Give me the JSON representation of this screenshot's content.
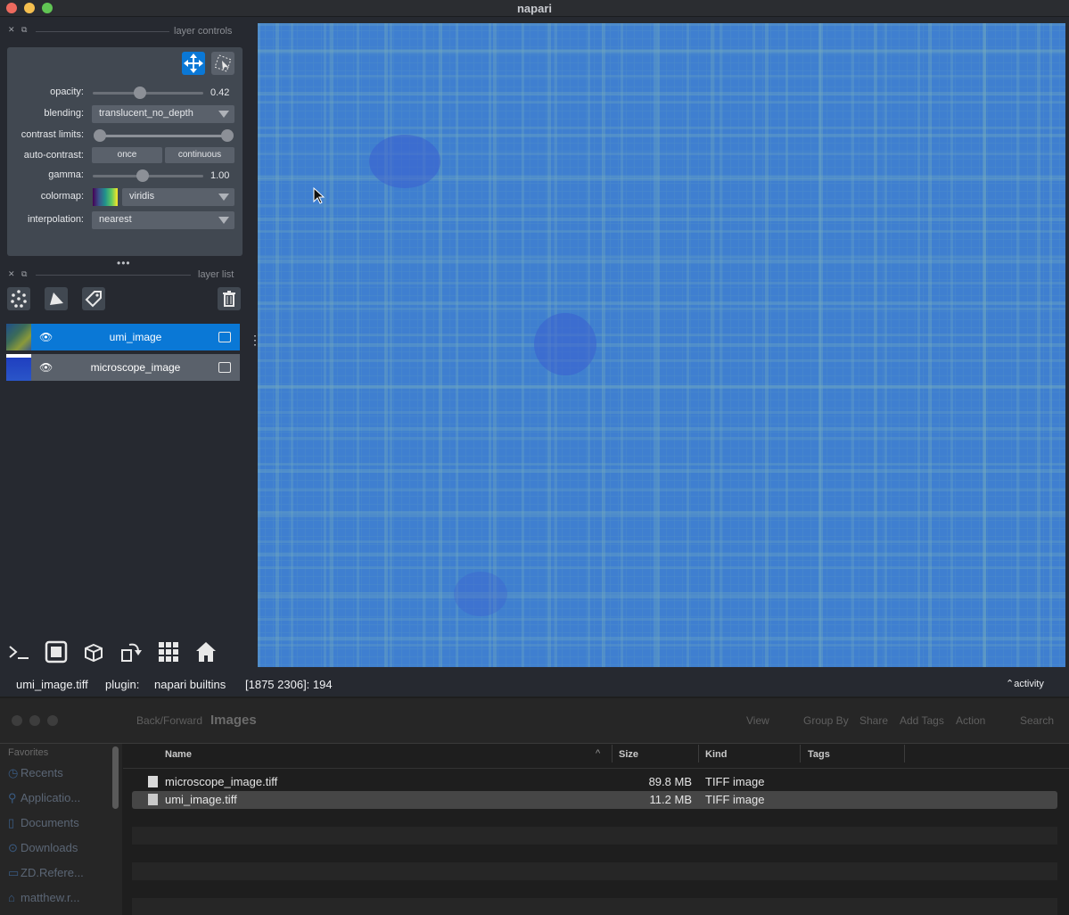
{
  "window": {
    "title": "napari",
    "close_color": "#ed6a5e",
    "min_color": "#f5bf4f",
    "max_color": "#61c554"
  },
  "layer_controls": {
    "header": "layer controls",
    "opacity": {
      "label": "opacity:",
      "value": "0.42",
      "fraction": 0.42
    },
    "blending": {
      "label": "blending:",
      "value": "translucent_no_depth"
    },
    "contrast_limits": {
      "label": "contrast limits:"
    },
    "auto_contrast": {
      "label": "auto-contrast:",
      "once": "once",
      "continuous": "continuous"
    },
    "gamma": {
      "label": "gamma:",
      "value": "1.00"
    },
    "colormap": {
      "label": "colormap:",
      "value": "viridis"
    },
    "interpolation": {
      "label": "interpolation:",
      "value": "nearest"
    },
    "mode_icons": [
      "move-arrows-icon",
      "transform-icon"
    ]
  },
  "layer_list": {
    "header": "layer list",
    "tools": [
      "points-icon",
      "shapes-icon",
      "labels-icon",
      "trash-icon"
    ],
    "layers": [
      {
        "name": "umi_image",
        "selected": true,
        "visible": true
      },
      {
        "name": "microscope_image",
        "selected": false,
        "visible": true
      }
    ]
  },
  "bottom_toolbar": [
    "console-icon",
    "ndisplay-icon",
    "roll-dims-icon",
    "transpose-icon",
    "grid-icon",
    "home-icon"
  ],
  "status": {
    "file": "umi_image.tiff",
    "plugin_label": "plugin:",
    "plugin": "napari builtins",
    "coords": "[1875 2306]: 194",
    "activity": "activity"
  },
  "accent": "#0a78d6",
  "finder": {
    "toolbar": {
      "back_forward": "Back/Forward",
      "title": "Images",
      "view": "View",
      "group_by": "Group By",
      "share": "Share",
      "add_tags": "Add Tags",
      "action": "Action",
      "search": "Search"
    },
    "sidebar": {
      "heading": "Favorites",
      "items": [
        "Recents",
        "Applicatio...",
        "Documents",
        "Downloads",
        "ZD.Refere...",
        "matthew.r..."
      ]
    },
    "columns": [
      "Name",
      "Size",
      "Kind",
      "Tags"
    ],
    "files": [
      {
        "name": "microscope_image.tiff",
        "size": "89.8 MB",
        "kind": "TIFF image",
        "selected": false
      },
      {
        "name": "umi_image.tiff",
        "size": "11.2 MB",
        "kind": "TIFF image",
        "selected": true
      }
    ]
  }
}
